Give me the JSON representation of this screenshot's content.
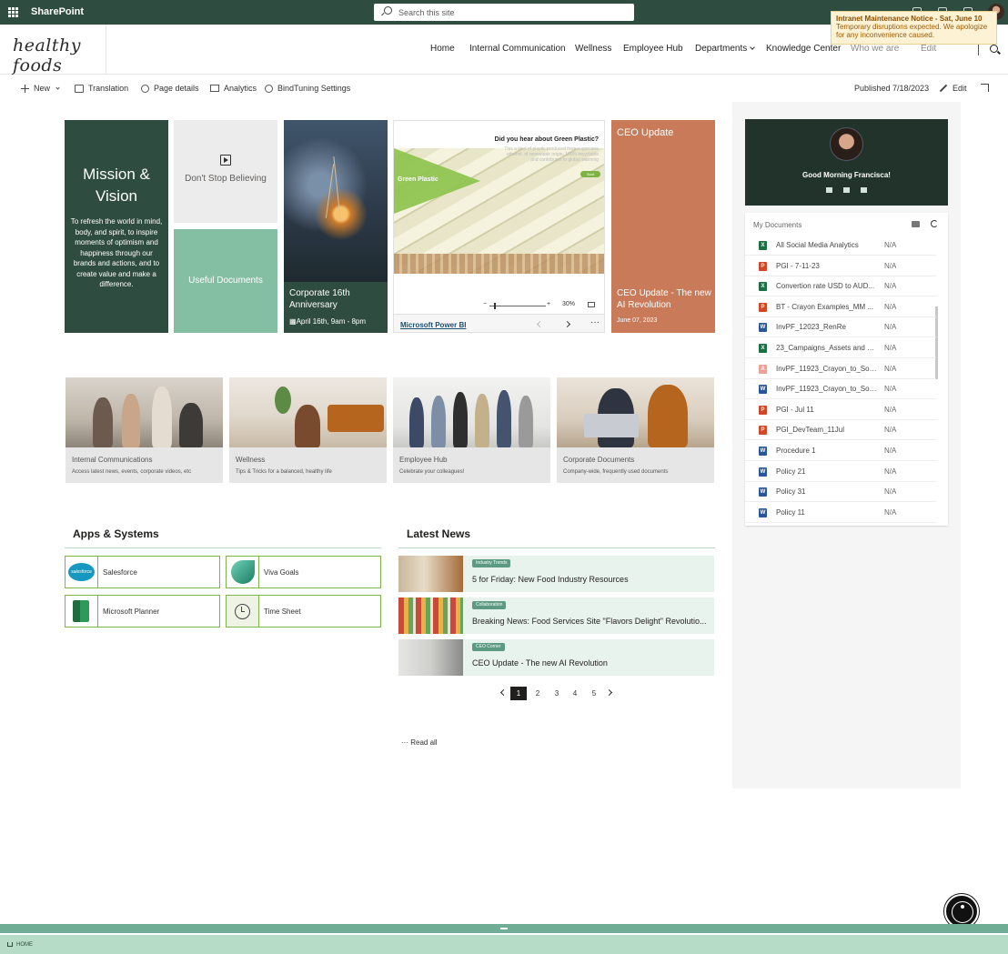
{
  "suitebar": {
    "app_name": "SharePoint",
    "search_placeholder": "Search this site"
  },
  "notice": {
    "title": "Intranet Maintenance Notice - Sat, June 10",
    "text": "Temporary disruptions expected. We apologize for any inconvenience caused."
  },
  "site": {
    "logo": "healthy foods"
  },
  "nav": [
    "Home",
    "Internal Communication",
    "Wellness",
    "Employee Hub",
    "Departments",
    "Knowledge Center",
    "Who we are",
    "Edit"
  ],
  "command_bar": {
    "new": "New",
    "translation": "Translation",
    "page_details": "Page details",
    "analytics": "Analytics",
    "bindtuning": "BindTuning Settings",
    "published": "Published 7/18/2023",
    "edit": "Edit"
  },
  "hero": {
    "mission_title": "Mission & Vision",
    "mission_text": "To refresh the world in mind, body, and spirit, to inspire moments of optimism and happiness through our brands and actions, and to create value and make a difference.",
    "dont_stop": "Don't Stop Believing",
    "useful_docs": "Useful Documents",
    "corp_title": "Corporate 16th Anniversary",
    "corp_date": "April 16th, 9am - 8pm",
    "pbi_question": "Did you hear about Green Plastic?",
    "pbi_sub": "This a kind of plastic produced from sugarcane ethanol, of renewable origin. 100% recyclable and contributes to global warming",
    "pbi_banner": "Green Plastic",
    "pbi_button": "Start",
    "pbi_zoom": "30%",
    "pbi_link": "Microsoft Power BI",
    "ceo_top": "CEO Update",
    "ceo_title": "CEO Update - The new AI Revolution",
    "ceo_date": "June 07, 2023"
  },
  "cards": [
    {
      "title": "Internal Communications",
      "sub": "Access latest news, events, corporate videos, etc"
    },
    {
      "title": "Wellness",
      "sub": "Tips & Tricks for a balanced, healthy life"
    },
    {
      "title": "Employee Hub",
      "sub": "Celebrate your colleagues!"
    },
    {
      "title": "Corporate Documents",
      "sub": "Company-wide, frequently used documents"
    }
  ],
  "apps": {
    "title": "Apps & Systems",
    "items": [
      "Salesforce",
      "Viva Goals",
      "Microsoft Planner",
      "Time Sheet"
    ],
    "sf_logo": "salesforce"
  },
  "news": {
    "title": "Latest News",
    "items": [
      {
        "tag": "Industry Trends",
        "title": "5 for Friday: New Food Industry Resources"
      },
      {
        "tag": "Collaboration",
        "title": "Breaking News: Food Services Site \"Flavors Delight\" Revolutio..."
      },
      {
        "tag": "CEO Corner",
        "title": "CEO Update - The new AI Revolution"
      }
    ],
    "pages": [
      "1",
      "2",
      "3",
      "4",
      "5"
    ],
    "read_all": "Read all"
  },
  "profile": {
    "greeting": "Good Morning Francisca!"
  },
  "docs": {
    "title": "My Documents",
    "items": [
      {
        "type": "X",
        "color": "#1d6f42",
        "name": "All Social Media Analytics",
        "value": "N/A"
      },
      {
        "type": "P",
        "color": "#d24726",
        "name": "PGI - 7-11-23",
        "value": "N/A"
      },
      {
        "type": "X",
        "color": "#1d6f42",
        "name": "Convertion rate USD to AUD...",
        "value": "N/A"
      },
      {
        "type": "P",
        "color": "#d24726",
        "name": "BT - Crayon Examples_MM ...",
        "value": "N/A"
      },
      {
        "type": "W",
        "color": "#2b579a",
        "name": "InvPF_12023_RenRe",
        "value": "N/A"
      },
      {
        "type": "X",
        "color": "#1d6f42",
        "name": "23_Campaigns_Assets and U...",
        "value": "N/A"
      },
      {
        "type": "A",
        "color": "#e8a29a",
        "name": "InvPF_11923_Crayon_to_Soud...",
        "value": "N/A"
      },
      {
        "type": "W",
        "color": "#2b579a",
        "name": "InvPF_11923_Crayon_to_Soud...",
        "value": "N/A"
      },
      {
        "type": "P",
        "color": "#d24726",
        "name": "PGI - Jul 11",
        "value": "N/A"
      },
      {
        "type": "P",
        "color": "#d24726",
        "name": "PGI_DevTeam_11Jul",
        "value": "N/A"
      },
      {
        "type": "W",
        "color": "#2b579a",
        "name": "Procedure 1",
        "value": "N/A"
      },
      {
        "type": "W",
        "color": "#2b579a",
        "name": "Policy 21",
        "value": "N/A"
      },
      {
        "type": "W",
        "color": "#2b579a",
        "name": "Policy 31",
        "value": "N/A"
      },
      {
        "type": "W",
        "color": "#2b579a",
        "name": "Policy 11",
        "value": "N/A"
      }
    ]
  },
  "footer": {
    "breadcrumb": "HOME"
  }
}
